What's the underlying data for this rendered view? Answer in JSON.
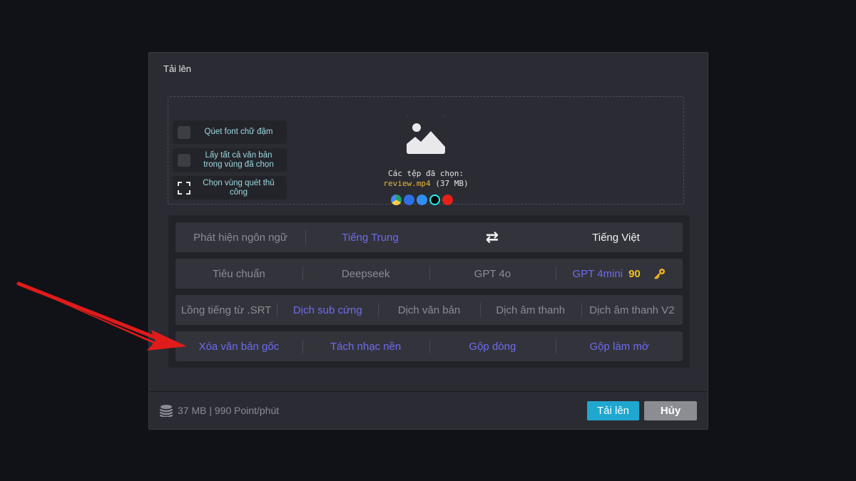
{
  "modal": {
    "title": "Tải lên"
  },
  "options": [
    {
      "label": "Qúet font chữ đậm"
    },
    {
      "label": "Lấy tất cả văn bản trong vùng đã chọn"
    },
    {
      "label": "Chọn vùng quét thủ công"
    }
  ],
  "files": {
    "label": "Các tệp đã chọn:",
    "name": "review.mp4",
    "size": "(37 MB)"
  },
  "sources": [
    "google-drive-icon",
    "dropbox-icon",
    "link-icon",
    "tiktok-icon",
    "youtube-icon"
  ],
  "language": {
    "detect": "Phát hiện ngôn ngữ",
    "source": "Tiếng Trung",
    "swap": "⇄",
    "target": "Tiếng Việt"
  },
  "models": {
    "standard": "Tiêu chuẩn",
    "deepseek": "Deepseek",
    "gpt4o": "GPT 4o",
    "gpt4mini": "GPT 4mini",
    "gpt4mini_points": "90"
  },
  "modes": {
    "dub_srt": "Lồng tiếng từ .SRT",
    "hard_sub": "Dịch sub cứng",
    "translate_text": "Dịch văn bản",
    "translate_audio": "Dịch âm thanh",
    "translate_audio_v2": "Dịch âm thanh V2"
  },
  "extras": {
    "remove_text": "Xóa văn bản gốc",
    "separate_music": "Tách nhạc nền",
    "merge_lines": "Gộp dòng",
    "merge_blur": "Gộp làm mờ"
  },
  "footer": {
    "cost": "37 MB | 990 Point/phút",
    "upload": "Tải lên",
    "cancel": "Hủy"
  },
  "colors": {
    "accent_blue": "#6f6bf0",
    "upload_button": "#1fa7d0",
    "arrow": "#e01b1b"
  }
}
